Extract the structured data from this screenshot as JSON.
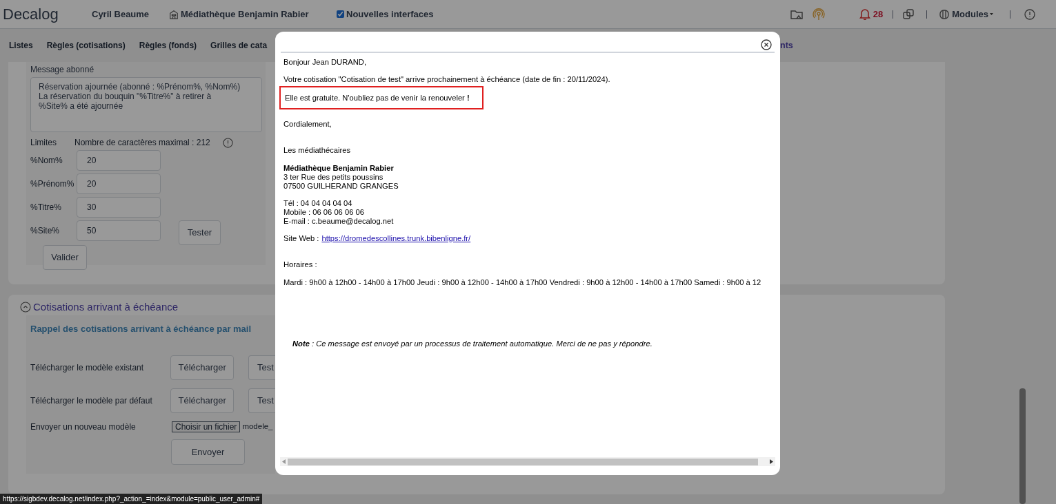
{
  "header": {
    "logo": "Decalog",
    "user": "Cyril Beaume",
    "library": "Médiathèque Benjamin Rabier",
    "new_interfaces": {
      "label": "Nouvelles interfaces",
      "checked": true
    },
    "notifications": "28",
    "modules": "Modules"
  },
  "tabs": [
    {
      "label": "Listes",
      "selected": false
    },
    {
      "label": "Règles (cotisations)",
      "selected": false
    },
    {
      "label": "Règles (fonds)",
      "selected": false
    },
    {
      "label": "Grilles de cata",
      "selected": false
    },
    {
      "label": "nts",
      "selected": true
    }
  ],
  "message_section": {
    "label": "Message abonné",
    "message": "Réservation ajournée (abonné : %Prénom%, %Nom%)\nLa réservation du bouquin \"%Titre%\" à retirer à\n%Site% a été ajournée",
    "limits_label": "Limites",
    "max_chars": "Nombre de caractères maximal : 212",
    "limits": [
      {
        "label": "%Nom%",
        "value": "20"
      },
      {
        "label": "%Prénom%",
        "value": "20"
      },
      {
        "label": "%Titre%",
        "value": "30"
      },
      {
        "label": "%Site%",
        "value": "50"
      }
    ],
    "test_button": "Tester",
    "validate_button": "Valider"
  },
  "due_section": {
    "title": "Cotisations arrivant à échéance",
    "expanded": true,
    "subtitle": "Rappel des cotisations arrivant à échéance par mail",
    "rows": [
      {
        "label": "Télécharger le modèle existant",
        "download": "Télécharger",
        "test": "Test"
      },
      {
        "label": "Télécharger le modèle par défaut",
        "download": "Télécharger",
        "test": "Test"
      }
    ],
    "upload": {
      "label": "Envoyer un nouveau modèle",
      "choose": "Choisir un fichier",
      "file": "modele_",
      "send": "Envoyer"
    }
  },
  "status_url": "https://sigbdev.decalog.net/index.php?_action_=index&module=public_user_admin#",
  "email": {
    "greeting": "Bonjour Jean DURAND,",
    "intro": "Votre cotisation \"Cotisation de test\" arrive prochainement à échéance (date de fin : 20/11/2024).",
    "highlight": "Elle est gratuite. N'oubliez pas de venir la renouveler **!**",
    "closing": "Cordialement,",
    "signature": "Les médiathécaires",
    "library_name": "Médiathèque Benjamin Rabier",
    "address": [
      "3 ter Rue des petits poussins",
      "07500 GUILHERAND GRANGES"
    ],
    "contacts": [
      "Tél : 04 04 04 04 04",
      "Mobile : 06 06 06 06 06",
      "E-mail : c.beaume@decalog.net"
    ],
    "website_label": "Site Web :",
    "website_url": "https://dromedescollines.trunk.bibenligne.fr/",
    "hours_label": "Horaires :",
    "hours": "Mardi : 9h00 à 12h00 - 14h00 à 17h00 Jeudi : 9h00 à 12h00 - 14h00 à 17h00 Vendredi : 9h00 à 12h00 - 14h00 à 17h00 Samedi : 9h00 à 12",
    "note": "**Note** : Ce message est envoyé par un processus de traitement automatique. Merci de ne pas y répondre."
  }
}
